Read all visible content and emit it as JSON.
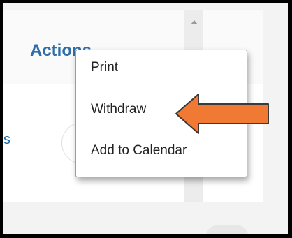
{
  "header": {
    "actions_label": "Actions"
  },
  "background": {
    "partial_text": "s"
  },
  "actions_menu": {
    "items": [
      {
        "label": "Print"
      },
      {
        "label": "Withdraw"
      },
      {
        "label": "Add to Calendar"
      }
    ]
  },
  "annotation": {
    "arrow_color": "#f07a34",
    "arrow_outline": "#3a3a3a",
    "icon": "left-arrow-icon"
  },
  "colors": {
    "frame": "#000000",
    "link": "#2f6ea9"
  }
}
